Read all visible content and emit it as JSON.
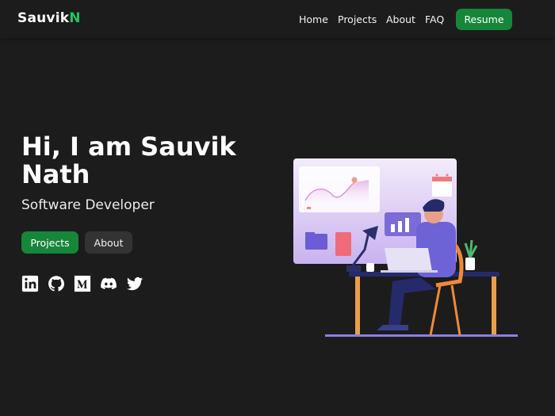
{
  "brand": {
    "name_main": "Sauvik",
    "name_accent": "N"
  },
  "nav": {
    "links": [
      "Home",
      "Projects",
      "About",
      "FAQ"
    ],
    "resume": "Resume"
  },
  "hero": {
    "title": "Hi, I am Sauvik Nath",
    "subtitle": "Software Developer",
    "projects_button": "Projects",
    "about_button": "About"
  },
  "social": [
    "linkedin-icon",
    "github-icon",
    "medium-icon",
    "discord-icon",
    "twitter-icon"
  ],
  "colors": {
    "background": "#1c1c1c",
    "accent": "#22c55e",
    "button": "#16863a",
    "secondary_button": "#333333"
  }
}
